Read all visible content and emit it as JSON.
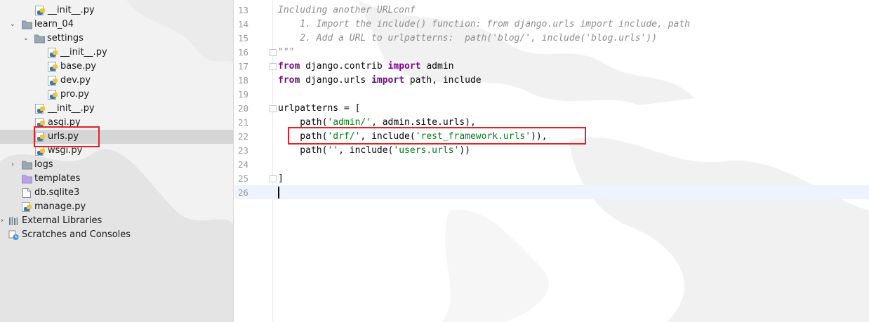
{
  "tree": {
    "items": [
      {
        "label": "__init__.py",
        "type": "py"
      },
      {
        "label": "learn_04",
        "type": "folder",
        "expanded": true
      },
      {
        "label": "settings",
        "type": "folder",
        "expanded": true
      },
      {
        "label": "__init__.py",
        "type": "py"
      },
      {
        "label": "base.py",
        "type": "py"
      },
      {
        "label": "dev.py",
        "type": "py"
      },
      {
        "label": "pro.py",
        "type": "py"
      },
      {
        "label": "__init__.py",
        "type": "py"
      },
      {
        "label": "asgi.py",
        "type": "py"
      },
      {
        "label": "urls.py",
        "type": "py",
        "selected": true
      },
      {
        "label": "wsgi.py",
        "type": "py"
      },
      {
        "label": "logs",
        "type": "folder",
        "expanded": false
      },
      {
        "label": "templates",
        "type": "folder-purple"
      },
      {
        "label": "db.sqlite3",
        "type": "file"
      },
      {
        "label": "manage.py",
        "type": "py"
      },
      {
        "label": "External Libraries",
        "type": "libraries"
      },
      {
        "label": "Scratches and Consoles",
        "type": "scratches"
      }
    ]
  },
  "editor": {
    "line_numbers": [
      "13",
      "14",
      "15",
      "16",
      "17",
      "18",
      "19",
      "20",
      "21",
      "22",
      "23",
      "24",
      "25",
      "26"
    ],
    "lines": {
      "l13": "Including another URLconf",
      "l14": "    1. Import the include() function: from django.urls import include, path",
      "l15": "    2. Add a URL to urlpatterns:  path('blog/', include('blog.urls'))",
      "l16": "\"\"\"",
      "l17_kw1": "from",
      "l17_mid": " django.contrib ",
      "l17_kw2": "import",
      "l17_end": " admin",
      "l18_kw1": "from",
      "l18_mid": " django.urls ",
      "l18_kw2": "import",
      "l18_end": " path, include",
      "l20": "urlpatterns = [",
      "l21_a": "    path(",
      "l21_s": "'admin/'",
      "l21_b": ", admin.site.urls),",
      "l22_a": "    path(",
      "l22_s1": "'drf/'",
      "l22_b": ", include(",
      "l22_s2": "'rest_framework.urls'",
      "l22_c": ")),",
      "l23_a": "    path(",
      "l23_s1": "''",
      "l23_b": ", include(",
      "l23_s2": "'users.urls'",
      "l23_c": "))",
      "l25": "]"
    }
  },
  "colors": {
    "highlight_box": "#e0222b",
    "keyword": "#7a0a8a",
    "string": "#067d17",
    "comment": "#8c8c8c",
    "current_line": "#edf3ff",
    "tree_selection": "#d5d5d5"
  }
}
